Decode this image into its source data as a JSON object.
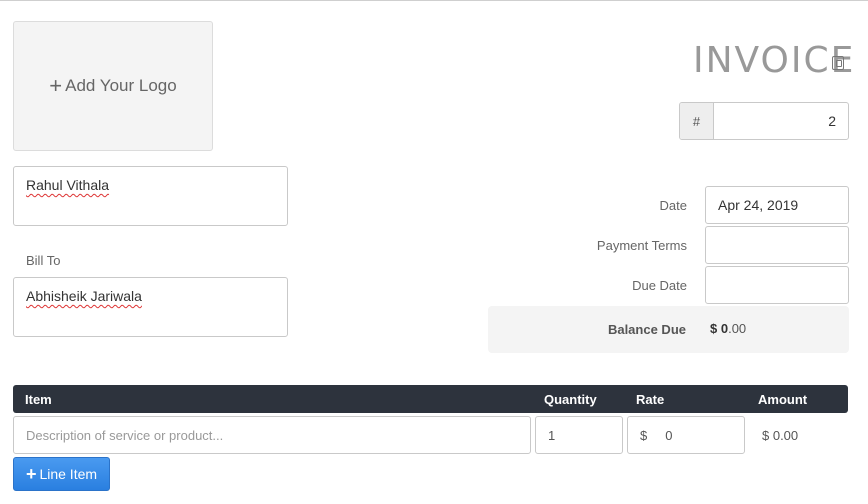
{
  "logo": {
    "plus": "+",
    "label": "Add Your Logo"
  },
  "from": {
    "value": "Rahul Vithala"
  },
  "bill_to": {
    "label": "Bill To",
    "value": "Abhisheik Jariwala"
  },
  "invoice": {
    "title": "INVOICE",
    "number_prefix": "#",
    "number": "2"
  },
  "fields": {
    "date_label": "Date",
    "date_value": "Apr 24, 2019",
    "payment_terms_label": "Payment Terms",
    "payment_terms_value": "",
    "due_date_label": "Due Date",
    "due_date_value": ""
  },
  "balance": {
    "label": "Balance Due",
    "currency": "$",
    "whole": "0",
    "cents": ".00"
  },
  "table": {
    "headers": {
      "item": "Item",
      "quantity": "Quantity",
      "rate": "Rate",
      "amount": "Amount"
    },
    "rows": [
      {
        "description_placeholder": "Description of service or product...",
        "quantity": "1",
        "rate_currency": "$",
        "rate": "0",
        "amount": "$ 0.00"
      }
    ]
  },
  "add_line": {
    "plus": "+",
    "label": "Line Item"
  },
  "colors": {
    "header_bg": "#2d333d",
    "button_blue": "#2a7fe0"
  }
}
